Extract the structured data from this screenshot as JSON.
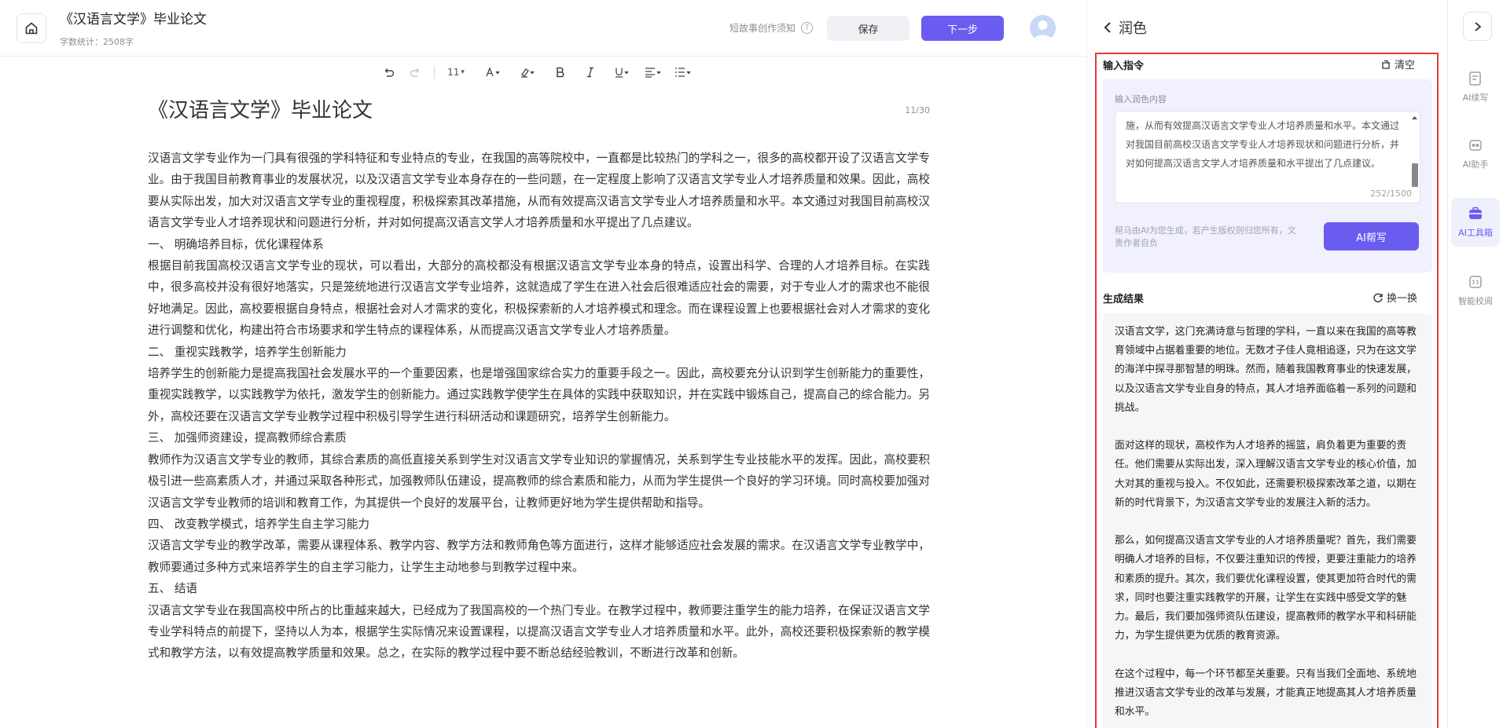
{
  "header": {
    "title": "《汉语言文学》毕业论文",
    "word_count": "字数统计：2508字",
    "tips_label": "短故事创作须知",
    "save_label": "保存",
    "next_label": "下一步"
  },
  "toolbar": {
    "font_size": "11",
    "font_size_caret": "▾"
  },
  "document": {
    "heading": "《汉语言文学》毕业论文",
    "page_counter": "11/30",
    "paragraphs": [
      "汉语言文学专业作为一门具有很强的学科特征和专业特点的专业，在我国的高等院校中，一直都是比较热门的学科之一，很多的高校都开设了汉语言文学专业。由于我国目前教育事业的发展状况，以及汉语言文学专业本身存在的一些问题，在一定程度上影响了汉语言文学专业人才培养质量和效果。因此，高校要从实际出发，加大对汉语言文学专业的重视程度，积极探索其改革措施，从而有效提高汉语言文学专业人才培养质量和水平。本文通过对我国目前高校汉语言文学专业人才培养现状和问题进行分析，并对如何提高汉语言文学人才培养质量和水平提出了几点建议。",
      "一、 明确培养目标，优化课程体系",
      "根据目前我国高校汉语言文学专业的现状，可以看出，大部分的高校都没有根据汉语言文学专业本身的特点，设置出科学、合理的人才培养目标。在实践中，很多高校并没有很好地落实，只是笼统地进行汉语言文学专业培养，这就造成了学生在进入社会后很难适应社会的需要，对于专业人才的需求也不能很好地满足。因此，高校要根据自身特点，根据社会对人才需求的变化，积极探索新的人才培养模式和理念。而在课程设置上也要根据社会对人才需求的变化进行调整和优化，构建出符合市场要求和学生特点的课程体系，从而提高汉语言文学专业人才培养质量。",
      "二、 重视实践教学，培养学生创新能力",
      "培养学生的创新能力是提高我国社会发展水平的一个重要因素，也是增强国家综合实力的重要手段之一。因此，高校要充分认识到学生创新能力的重要性，重视实践教学，以实践教学为依托，激发学生的创新能力。通过实践教学使学生在具体的实践中获取知识，并在实践中锻炼自己，提高自己的综合能力。另外，高校还要在汉语言文学专业教学过程中积极引导学生进行科研活动和课题研究，培养学生创新能力。",
      "三、 加强师资建设，提高教师综合素质",
      "教师作为汉语言文学专业的教师，其综合素质的高低直接关系到学生对汉语言文学专业知识的掌握情况，关系到学生专业技能水平的发挥。因此，高校要积极引进一些高素质人才，并通过采取各种形式，加强教师队伍建设，提高教师的综合素质和能力，从而为学生提供一个良好的学习环境。同时高校要加强对汉语言文学专业教师的培训和教育工作，为其提供一个良好的发展平台，让教师更好地为学生提供帮助和指导。",
      "四、 改变教学模式，培养学生自主学习能力",
      "汉语言文学专业的教学改革，需要从课程体系、教学内容、教学方法和教师角色等方面进行，这样才能够适应社会发展的需求。在汉语言文学专业教学中，教师要通过多种方式来培养学生的自主学习能力，让学生主动地参与到教学过程中来。",
      "五、 结语",
      "汉语言文学专业在我国高校中所占的比重越来越大，已经成为了我国高校的一个热门专业。在教学过程中，教师要注重学生的能力培养，在保证汉语言文学专业学科特点的前提下，坚持以人为本，根据学生实际情况来设置课程，以提高汉语言文学专业人才培养质量和水平。此外，高校还要积极探索新的教学模式和教学方法，以有效提高教学质量和效果。总之，在实际的教学过程中要不断总结经验教训，不断进行改革和创新。"
    ]
  },
  "panel": {
    "title": "润色",
    "input_section_title": "输入指令",
    "clear_label": "清空",
    "input_label": "输入润色内容",
    "input_text": "施，从而有效提高汉语言文学专业人才培养质量和水平。本文通过对我国目前高校汉语言文学专业人才培养现状和问题进行分析，并对如何提高汉语言文学人才培养质量和水平提出了几点建议。",
    "char_count": "252/1500",
    "disclaimer": "帮马由AI为您生成，若产生版权则归您所有，文责作者自负",
    "ai_write_label": "AI帮写",
    "result_section_title": "生成结果",
    "swap_label": "换一换",
    "result_paragraphs": [
      "汉语言文学，这门充满诗意与哲理的学科，一直以来在我国的高等教育领域中占据着重要的地位。无数才子佳人竟相追逐，只为在这文学的海洋中探寻那智慧的明珠。然而，随着我国教育事业的快速发展，以及汉语言文学专业自身的特点，其人才培养面临着一系列的问题和挑战。",
      "面对这样的现状，高校作为人才培养的摇篮，肩负着更为重要的责任。他们需要从实际出发，深入理解汉语言文学专业的核心价值，加大对其的重视与投入。不仅如此，还需要积极探索改革之道，以期在新的时代背景下，为汉语言文学专业的发展注入新的活力。",
      "那么，如何提高汉语言文学专业的人才培养质量呢？首先，我们需要明确人才培养的目标，不仅要注重知识的传授，更要注重能力的培养和素质的提升。其次，我们要优化课程设置，使其更加符合时代的需求，同时也要注重实践教学的开展，让学生在实践中感受文学的魅力。最后，我们要加强师资队伍建设，提高教师的教学水平和科研能力，为学生提供更为优质的教育资源。",
      "在这个过程中，每一个环节都至关重要。只有当我们全面地、系统地推进汉语言文学专业的改革与发展，才能真正地提高其人才培养质量和水平。"
    ]
  },
  "sidebar": {
    "items": [
      {
        "label": "AI续写"
      },
      {
        "label": "AI助手"
      },
      {
        "label": "AI工具箱"
      },
      {
        "label": "智能校阅"
      }
    ]
  },
  "colors": {
    "accent": "#6b5cf0",
    "highlight_border": "#e53935"
  }
}
